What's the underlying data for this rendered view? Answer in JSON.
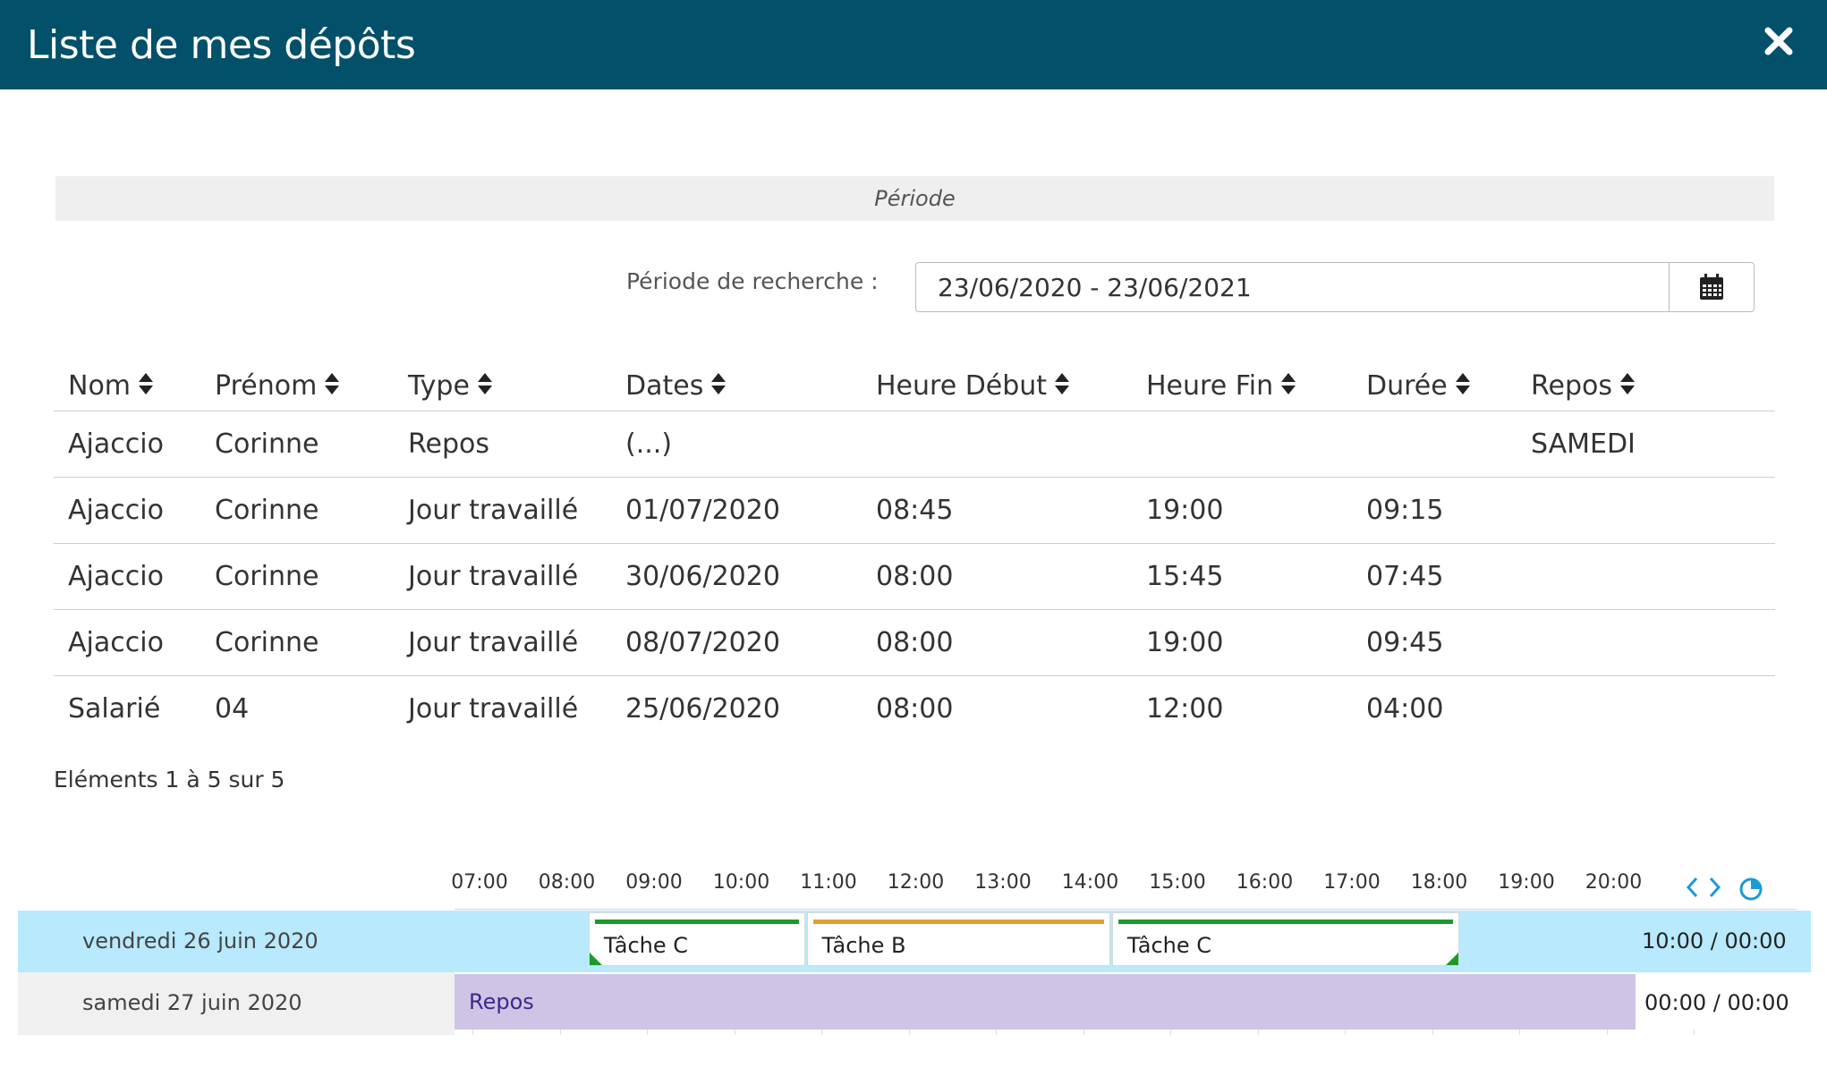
{
  "header": {
    "title": "Liste de mes dépôts",
    "close_icon": "close-icon"
  },
  "periode": {
    "section_label": "Période",
    "search_label": "Période de recherche :",
    "search_value": "23/06/2020 - 23/06/2021",
    "calendar_icon": "calendar-icon"
  },
  "table": {
    "columns": [
      "Nom",
      "Prénom",
      "Type",
      "Dates",
      "Heure Début",
      "Heure Fin",
      "Durée",
      "Repos"
    ],
    "rows": [
      [
        "Ajaccio",
        "Corinne",
        "Repos",
        "(...)",
        "",
        "",
        "",
        "SAMEDI"
      ],
      [
        "Ajaccio",
        "Corinne",
        "Jour travaillé",
        "01/07/2020",
        "08:45",
        "19:00",
        "09:15",
        ""
      ],
      [
        "Ajaccio",
        "Corinne",
        "Jour travaillé",
        "30/06/2020",
        "08:00",
        "15:45",
        "07:45",
        ""
      ],
      [
        "Ajaccio",
        "Corinne",
        "Jour travaillé",
        "08/07/2020",
        "08:00",
        "19:00",
        "09:45",
        ""
      ],
      [
        "Salarié",
        "04",
        "Jour travaillé",
        "25/06/2020",
        "08:00",
        "12:00",
        "04:00",
        ""
      ]
    ],
    "info": "Eléments 1 à 5 sur 5"
  },
  "timeline": {
    "hours": [
      "07:00",
      "08:00",
      "09:00",
      "10:00",
      "11:00",
      "12:00",
      "13:00",
      "14:00",
      "15:00",
      "16:00",
      "17:00",
      "18:00",
      "19:00",
      "20:00"
    ],
    "rows": [
      {
        "date": "vendredi 26 juin 2020",
        "total": "10:00 / 00:00",
        "tasks": [
          {
            "label": "Tâche C",
            "start": "08:15",
            "end": "10:45",
            "color": "#1a9a2a"
          },
          {
            "label": "Tâche B",
            "start": "10:45",
            "end": "14:15",
            "color": "#e0a030"
          },
          {
            "label": "Tâche C",
            "start": "14:15",
            "end": "18:15",
            "color": "#1a9a2a"
          }
        ]
      },
      {
        "date": "samedi 27 juin 2020",
        "total": "00:00 / 00:00",
        "repos": {
          "label": "Repos",
          "color": "#d0c4e6"
        }
      }
    ]
  },
  "colors": {
    "header_bg": "#02506a",
    "row_highlight": "#b8e9fc",
    "accent": "#1a9bd4"
  }
}
